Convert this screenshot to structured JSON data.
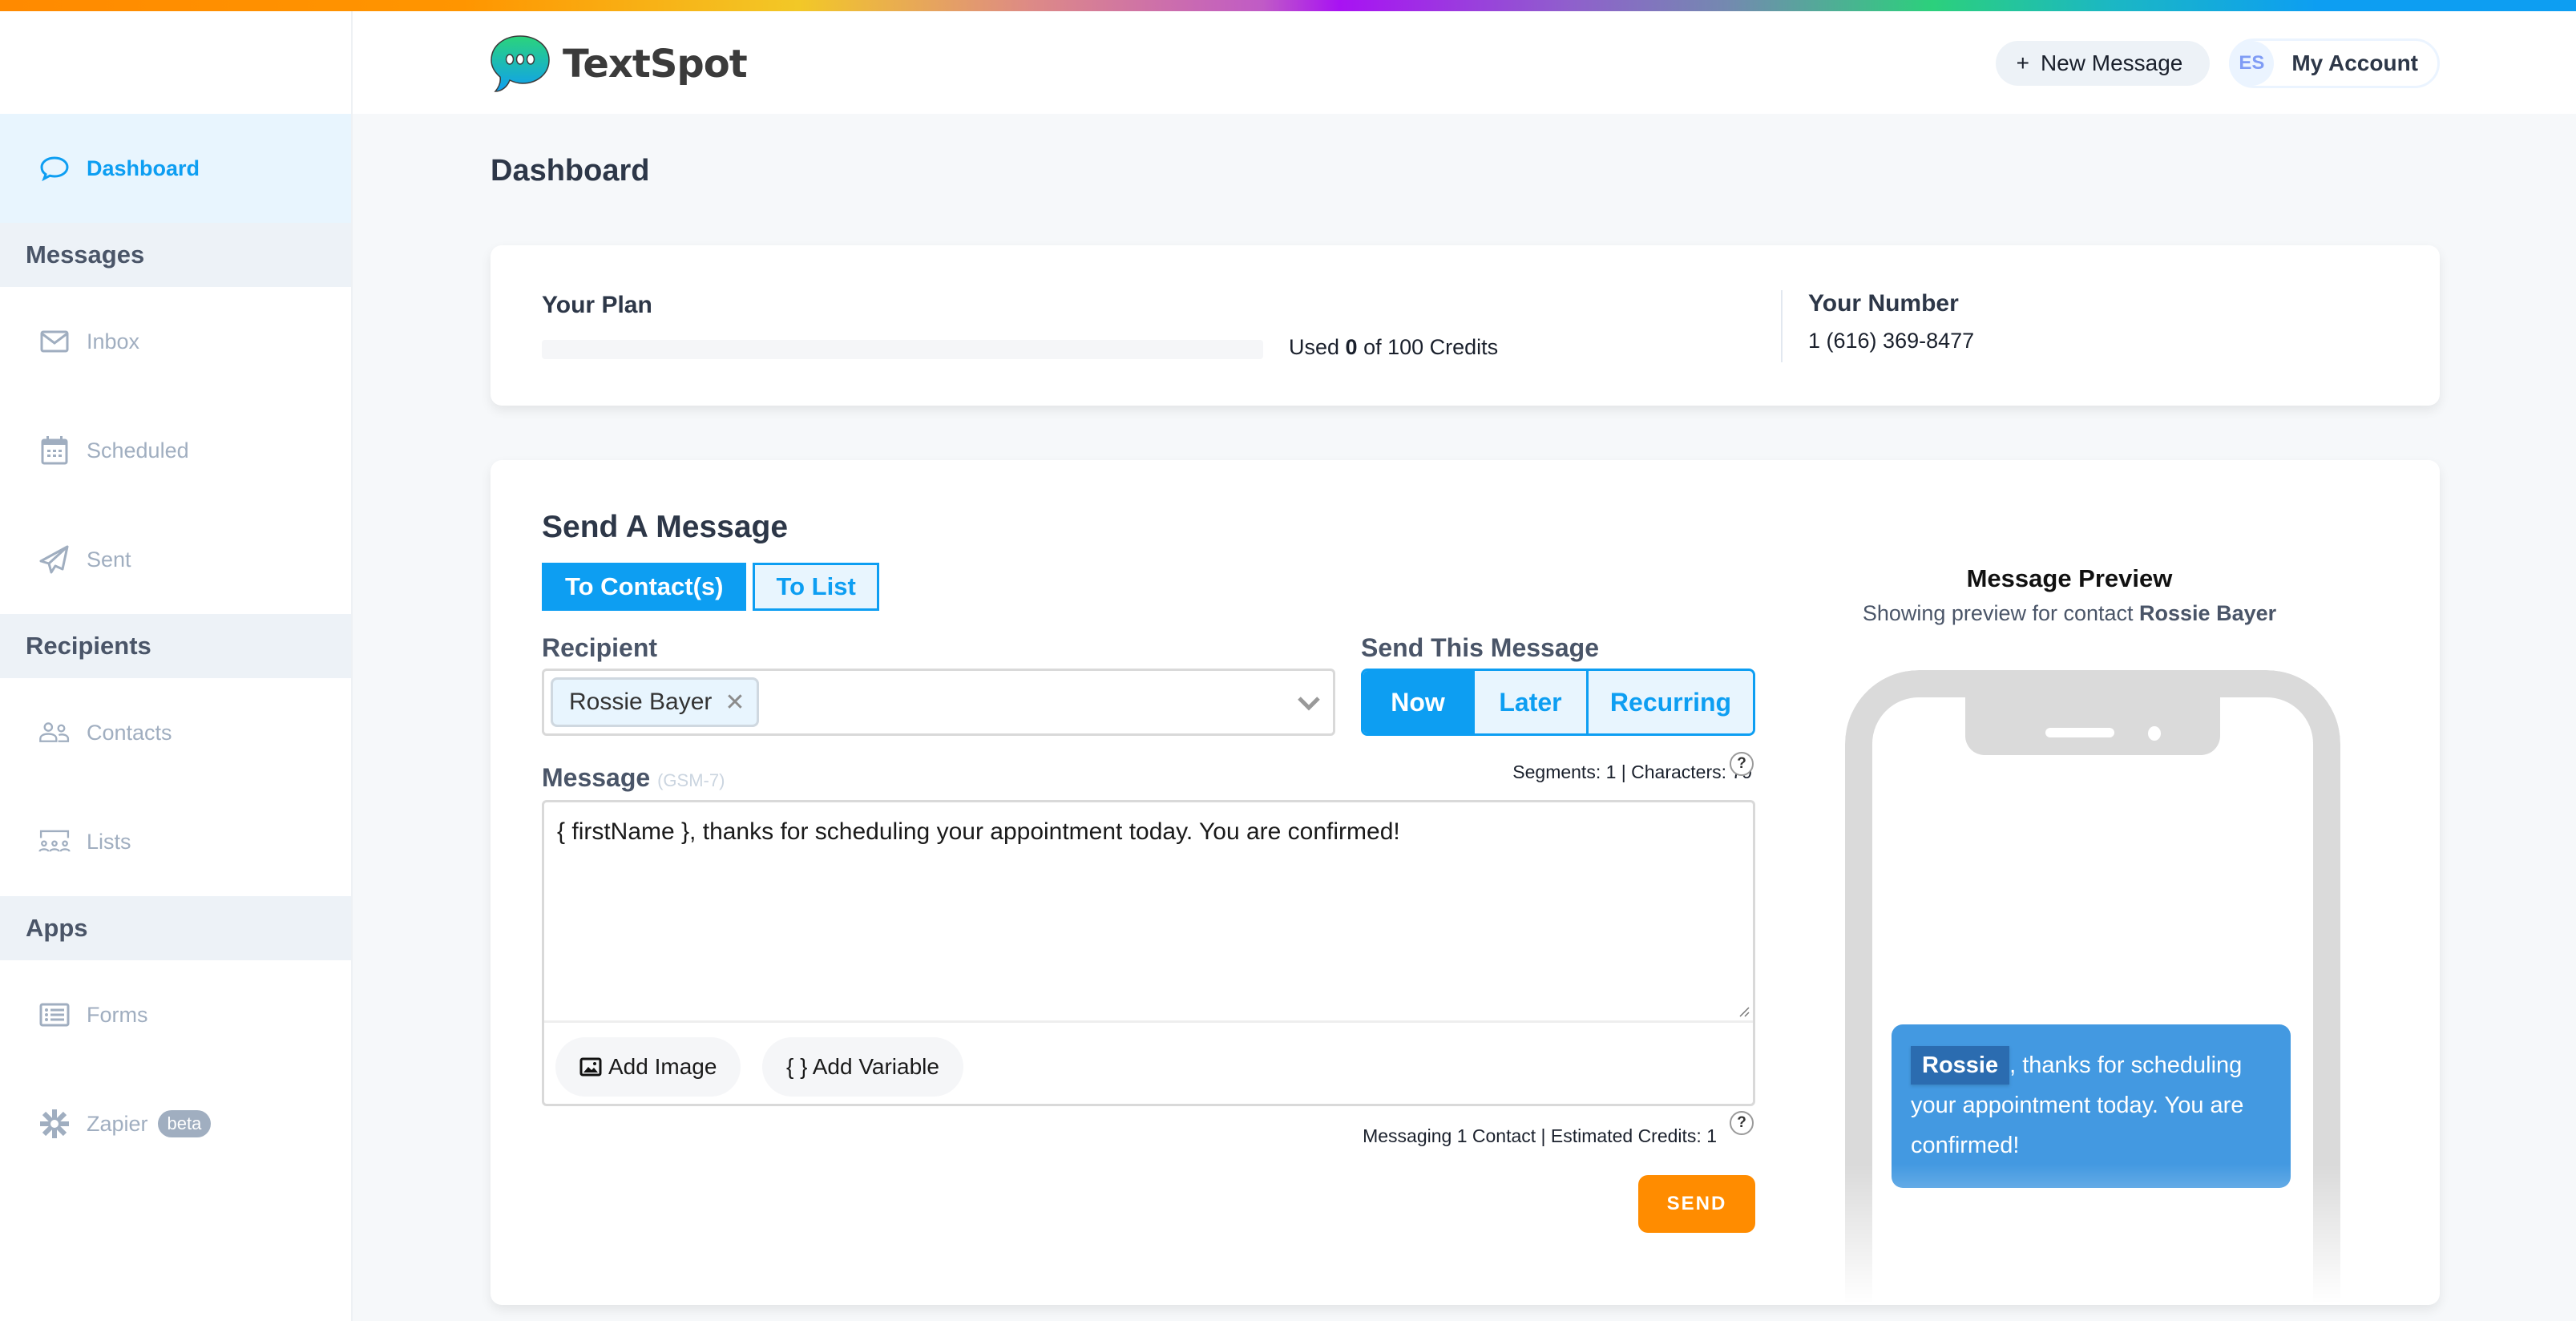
{
  "app": {
    "name": "TextSpot",
    "brand_colors": {
      "primary": "#0d9ef2",
      "send": "#ff8c00",
      "preview_bubble": "#4399e1"
    }
  },
  "header": {
    "new_message_label": "New Message",
    "new_message_icon": "plus-icon",
    "account_initials": "ES",
    "account_label": "My Account"
  },
  "sidebar": {
    "items": [
      {
        "type": "item",
        "label": "Dashboard",
        "icon": "chat-bubble-icon",
        "active": true
      },
      {
        "type": "section",
        "label": "Messages"
      },
      {
        "type": "item",
        "label": "Inbox",
        "icon": "envelope-icon"
      },
      {
        "type": "item",
        "label": "Scheduled",
        "icon": "calendar-icon"
      },
      {
        "type": "item",
        "label": "Sent",
        "icon": "paper-plane-icon"
      },
      {
        "type": "section",
        "label": "Recipients"
      },
      {
        "type": "item",
        "label": "Contacts",
        "icon": "users-icon"
      },
      {
        "type": "item",
        "label": "Lists",
        "icon": "group-list-icon"
      },
      {
        "type": "section",
        "label": "Apps"
      },
      {
        "type": "item",
        "label": "Forms",
        "icon": "list-icon"
      },
      {
        "type": "item",
        "label": "Zapier",
        "icon": "asterisk-icon",
        "badge": "beta"
      }
    ]
  },
  "page": {
    "title": "Dashboard"
  },
  "plan": {
    "title": "Your Plan",
    "credits_prefix": "Used ",
    "credits_used": "0",
    "credits_suffix": " of 100 Credits",
    "credits_total": 100,
    "usage_fraction": 0,
    "number_title": "Your Number",
    "number_value": "1 (616) 369-8477"
  },
  "send": {
    "title": "Send A Message",
    "mode_tabs": [
      {
        "label": "To Contact(s)",
        "active": true
      },
      {
        "label": "To List",
        "active": false
      }
    ],
    "recipient_label": "Recipient",
    "recipient_chip": "Rossie Bayer",
    "schedule_label": "Send This Message",
    "schedule_options": [
      {
        "label": "Now",
        "active": true
      },
      {
        "label": "Later",
        "active": false
      },
      {
        "label": "Recurring",
        "active": false
      }
    ],
    "message_label": "Message",
    "encoding": "(GSM-7)",
    "counter": "Segments: 1 |  Characters: 79",
    "message_value": "{ firstName }, thanks for scheduling your appointment today. You are confirmed!",
    "add_image_label": "Add Image",
    "add_variable_label": "{ } Add Variable",
    "estimate": "Messaging 1 Contact | Estimated Credits: 1",
    "help_glyph": "?",
    "send_label": "SEND"
  },
  "preview": {
    "title": "Message Preview",
    "subtitle_prefix": "Showing preview for contact ",
    "subtitle_contact": "Rossie Bayer",
    "variable_value": "Rossie",
    "message_rest": ", thanks for scheduling your appointment today. You are confirmed!"
  }
}
